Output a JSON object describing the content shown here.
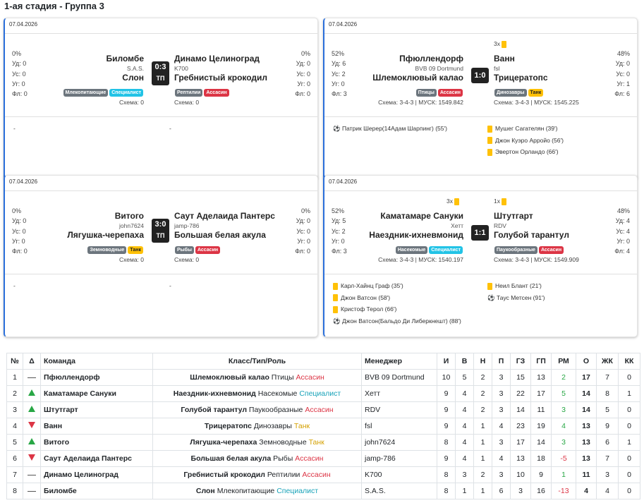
{
  "page": {
    "title": "1-ая стадия - Группа 3"
  },
  "matches": [
    {
      "date": "07.04.2026",
      "home": {
        "name": "Биломбе",
        "manager": "S.A.S.",
        "class": "Слон",
        "badges": [
          {
            "text": "Млекопитающие",
            "color": "gray"
          },
          {
            "text": "Специалист",
            "color": "cyan"
          }
        ],
        "schema": "Схема: 0",
        "stats": [
          "0%",
          "Уд: 0",
          "Ус: 0",
          "Уг: 0",
          "Фл: 0"
        ],
        "cards": ""
      },
      "away": {
        "name": "Динамо Целиноград",
        "manager": "K700",
        "class": "Гребнистый крокодил",
        "badges": [
          {
            "text": "Рептилии",
            "color": "gray"
          },
          {
            "text": "Ассасин",
            "color": "red"
          }
        ],
        "schema": "Схема: 0",
        "stats": [
          "0%",
          "Уд: 0",
          "Ус: 0",
          "Уг: 0",
          "Фл: 0"
        ],
        "cards": ""
      },
      "score": "0:3",
      "note": "ТП",
      "home_events": [
        {
          "icon": "",
          "text": "-"
        }
      ],
      "away_events": [
        {
          "icon": "",
          "text": "-"
        }
      ]
    },
    {
      "date": "07.04.2026",
      "home": {
        "name": "Пфюллендорф",
        "manager": "BVB 09 Dortmund",
        "class": "Шлемоклювый калао",
        "badges": [
          {
            "text": "Птицы",
            "color": "gray"
          },
          {
            "text": "Ассасин",
            "color": "red"
          }
        ],
        "schema": "Схема: 3-4-3 | МУСК: 1549.842",
        "stats": [
          "52%",
          "Уд: 6",
          "Ус: 2",
          "Уг: 0",
          "Фл: 3"
        ],
        "cards": ""
      },
      "away": {
        "name": "Ванн",
        "manager": "fsl",
        "class": "Трицератопс",
        "badges": [
          {
            "text": "Динозавры",
            "color": "gray"
          },
          {
            "text": "Танк",
            "color": "yellow"
          }
        ],
        "schema": "Схема: 3-4-3 | МУСК: 1545.225",
        "stats": [
          "48%",
          "Уд: 0",
          "Ус: 0",
          "Уг: 1",
          "Фл: 6"
        ],
        "cards": "3x"
      },
      "score": "1:0",
      "note": "",
      "home_events": [
        {
          "icon": "ball",
          "text": "Патрик Шерер(14Адам Шарпинг) (55')"
        }
      ],
      "away_events": [
        {
          "icon": "yellow",
          "text": "Мушег Сагателян (39')"
        },
        {
          "icon": "yellow",
          "text": "Джон Куэро Арройо (56')"
        },
        {
          "icon": "yellow",
          "text": "Эвертон Орландо (66')"
        }
      ]
    },
    {
      "date": "07.04.2026",
      "home": {
        "name": "Витого",
        "manager": "john7624",
        "class": "Лягушка-черепаха",
        "badges": [
          {
            "text": "Земноводные",
            "color": "gray"
          },
          {
            "text": "Танк",
            "color": "yellow"
          }
        ],
        "schema": "Схема: 0",
        "stats": [
          "0%",
          "Уд: 0",
          "Ус: 0",
          "Уг: 0",
          "Фл: 0"
        ],
        "cards": ""
      },
      "away": {
        "name": "Саут Аделаида Пантерс",
        "manager": "jamp-786",
        "class": "Большая белая акула",
        "badges": [
          {
            "text": "Рыбы",
            "color": "gray"
          },
          {
            "text": "Ассасин",
            "color": "red"
          }
        ],
        "schema": "Схема: 0",
        "stats": [
          "0%",
          "Уд: 0",
          "Ус: 0",
          "Уг: 0",
          "Фл: 0"
        ],
        "cards": ""
      },
      "score": "3:0",
      "note": "ТП",
      "home_events": [
        {
          "icon": "",
          "text": "-"
        }
      ],
      "away_events": [
        {
          "icon": "",
          "text": "-"
        }
      ]
    },
    {
      "date": "07.04.2026",
      "home": {
        "name": "Каматамаре Сануки",
        "manager": "Хетт",
        "class": "Наездник-ихневмонид",
        "badges": [
          {
            "text": "Насекомые",
            "color": "gray"
          },
          {
            "text": "Специалист",
            "color": "cyan"
          }
        ],
        "schema": "Схема: 3-4-3 | МУСК: 1540.197",
        "stats": [
          "52%",
          "Уд: 5",
          "Ус: 2",
          "Уг: 0",
          "Фл: 3"
        ],
        "cards": "3x"
      },
      "away": {
        "name": "Штутгарт",
        "manager": "RDV",
        "class": "Голубой тарантул",
        "badges": [
          {
            "text": "Паукообразные",
            "color": "gray"
          },
          {
            "text": "Ассасин",
            "color": "red"
          }
        ],
        "schema": "Схема: 3-4-3 | МУСК: 1549.909",
        "stats": [
          "48%",
          "Уд: 4",
          "Ус: 4",
          "Уг: 0",
          "Фл: 4"
        ],
        "cards": "1x"
      },
      "score": "1:1",
      "note": "",
      "home_events": [
        {
          "icon": "yellow",
          "text": "Карл-Хайнц Граф (35')"
        },
        {
          "icon": "yellow",
          "text": "Джон Ватсон (58')"
        },
        {
          "icon": "yellow",
          "text": "Кристоф Терол (66')"
        },
        {
          "icon": "ball",
          "text": "Джон Ватсон(Бальдо Ди Либеркнешт) (88')"
        }
      ],
      "away_events": [
        {
          "icon": "yellow",
          "text": "Неил Блант (21')"
        },
        {
          "icon": "ball",
          "text": "Таус Метсен (91')"
        }
      ]
    }
  ],
  "table": {
    "headers": [
      "№",
      "Δ",
      "Команда",
      "Класс/Тип/Роль",
      "Менеджер",
      "И",
      "В",
      "Н",
      "П",
      "ГЗ",
      "ГП",
      "РМ",
      "О",
      "ЖК",
      "КК"
    ],
    "rows": [
      {
        "pos": "1",
        "trend": "same",
        "team": "Пфюллендорф",
        "cls": "Шлемоклювый калао",
        "type": "Птицы",
        "role": "Ассасин",
        "role_color": "red",
        "manager": "BVB 09 Dortmund",
        "i": "10",
        "w": "5",
        "d": "2",
        "l": "3",
        "gf": "15",
        "ga": "13",
        "gd": "2",
        "gd_color": "green",
        "pts": "17",
        "yc": "7",
        "rc": "0"
      },
      {
        "pos": "2",
        "trend": "up",
        "team": "Каматамаре Сануки",
        "cls": "Наездник-ихневмонид",
        "type": "Насекомые",
        "role": "Специалист",
        "role_color": "cyan",
        "manager": "Хетт",
        "i": "9",
        "w": "4",
        "d": "2",
        "l": "3",
        "gf": "22",
        "ga": "17",
        "gd": "5",
        "gd_color": "green",
        "pts": "14",
        "yc": "8",
        "rc": "1"
      },
      {
        "pos": "3",
        "trend": "up",
        "team": "Штутгарт",
        "cls": "Голубой тарантул",
        "type": "Паукообразные",
        "role": "Ассасин",
        "role_color": "red",
        "manager": "RDV",
        "i": "9",
        "w": "4",
        "d": "2",
        "l": "3",
        "gf": "14",
        "ga": "11",
        "gd": "3",
        "gd_color": "green",
        "pts": "14",
        "yc": "5",
        "rc": "0"
      },
      {
        "pos": "4",
        "trend": "down",
        "team": "Ванн",
        "cls": "Трицератопс",
        "type": "Динозавры",
        "role": "Танк",
        "role_color": "gold",
        "manager": "fsl",
        "i": "9",
        "w": "4",
        "d": "1",
        "l": "4",
        "gf": "23",
        "ga": "19",
        "gd": "4",
        "gd_color": "green",
        "pts": "13",
        "yc": "9",
        "rc": "0"
      },
      {
        "pos": "5",
        "trend": "up",
        "team": "Витого",
        "cls": "Лягушка-черепаха",
        "type": "Земноводные",
        "role": "Танк",
        "role_color": "gold",
        "manager": "john7624",
        "i": "8",
        "w": "4",
        "d": "1",
        "l": "3",
        "gf": "17",
        "ga": "14",
        "gd": "3",
        "gd_color": "green",
        "pts": "13",
        "yc": "6",
        "rc": "1"
      },
      {
        "pos": "6",
        "trend": "down",
        "team": "Саут Аделаида Пантерс",
        "cls": "Большая белая акула",
        "type": "Рыбы",
        "role": "Ассасин",
        "role_color": "red",
        "manager": "jamp-786",
        "i": "9",
        "w": "4",
        "d": "1",
        "l": "4",
        "gf": "13",
        "ga": "18",
        "gd": "-5",
        "gd_color": "red",
        "pts": "13",
        "yc": "7",
        "rc": "0"
      },
      {
        "pos": "7",
        "trend": "same",
        "team": "Динамо Целиноград",
        "cls": "Гребнистый крокодил",
        "type": "Рептилии",
        "role": "Ассасин",
        "role_color": "red",
        "manager": "K700",
        "i": "8",
        "w": "3",
        "d": "2",
        "l": "3",
        "gf": "10",
        "ga": "9",
        "gd": "1",
        "gd_color": "green",
        "pts": "11",
        "yc": "3",
        "rc": "0"
      },
      {
        "pos": "8",
        "trend": "same",
        "team": "Биломбе",
        "cls": "Слон",
        "type": "Млекопитающие",
        "role": "Специалист",
        "role_color": "cyan",
        "manager": "S.A.S.",
        "i": "8",
        "w": "1",
        "d": "1",
        "l": "6",
        "gf": "3",
        "ga": "16",
        "gd": "-13",
        "gd_color": "red",
        "pts": "4",
        "yc": "4",
        "rc": "0"
      }
    ]
  }
}
